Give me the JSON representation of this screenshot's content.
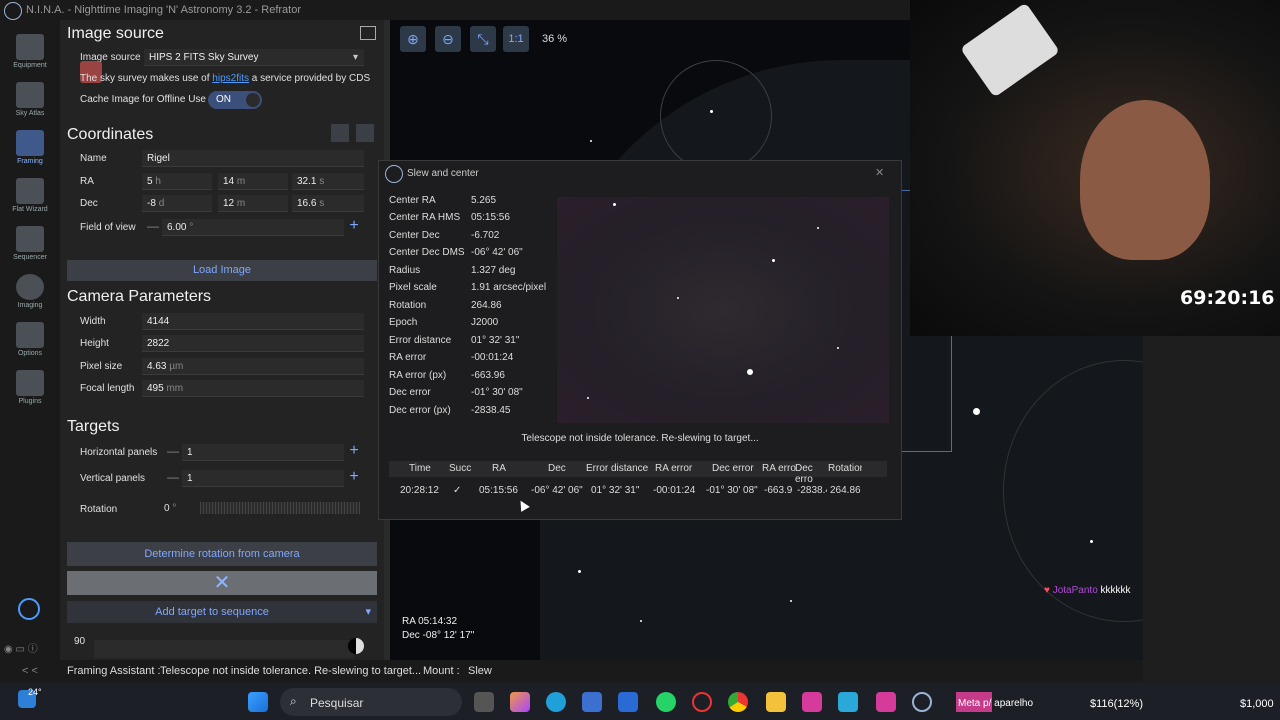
{
  "titlebar": {
    "title": "N.I.N.A. - Nighttime Imaging 'N' Astronomy 3.2  -  Refrator"
  },
  "nav": [
    {
      "label": "Equipment",
      "icon": "telescope-icon"
    },
    {
      "label": "Sky Atlas",
      "icon": "sky-atlas-icon"
    },
    {
      "label": "Framing",
      "icon": "framing-icon"
    },
    {
      "label": "Flat Wizard",
      "icon": "flat-wizard-icon"
    },
    {
      "label": "Sequencer",
      "icon": "sequencer-icon"
    },
    {
      "label": "Imaging",
      "icon": "imaging-icon"
    },
    {
      "label": "Options",
      "icon": "gear-icon"
    },
    {
      "label": "Plugins",
      "icon": "puzzle-icon"
    }
  ],
  "image_source": {
    "heading": "Image source",
    "label": "Image source",
    "value": "HIPS 2 FITS Sky Survey",
    "note_prefix": "The sky survey makes use of ",
    "note_link": "hips2fits",
    "note_suffix": " a service provided by CDS",
    "cache_label": "Cache Image for Offline Use",
    "cache_toggle": "ON"
  },
  "coordinates": {
    "heading": "Coordinates",
    "name_label": "Name",
    "name_value": "Rigel",
    "ra_label": "RA",
    "ra_h": "5",
    "ra_h_unit": "h",
    "ra_m": "14",
    "ra_m_unit": "m",
    "ra_s": "32.1",
    "ra_s_unit": "s",
    "dec_label": "Dec",
    "dec_d": "-8",
    "dec_d_unit": "d",
    "dec_m": "12",
    "dec_m_unit": "m",
    "dec_s": "16.6",
    "dec_s_unit": "s",
    "fov_label": "Field of view",
    "fov_minus": "—",
    "fov_value": "6.00",
    "fov_unit": "°",
    "fov_plus": "+"
  },
  "load_image": "Load Image",
  "camera": {
    "heading": "Camera Parameters",
    "width_label": "Width",
    "width_value": "4144",
    "height_label": "Height",
    "height_value": "2822",
    "pixel_label": "Pixel size",
    "pixel_value": "4.63",
    "pixel_unit": "µm",
    "focal_label": "Focal length",
    "focal_value": "495",
    "focal_unit": "mm"
  },
  "targets": {
    "heading": "Targets",
    "hpanels_label": "Horizontal panels",
    "hpanels_minus": "—",
    "hpanels_value": "1",
    "hpanels_plus": "+",
    "vpanels_label": "Vertical panels",
    "vpanels_minus": "—",
    "vpanels_value": "1",
    "vpanels_plus": "+",
    "rotation_label": "Rotation",
    "rotation_value": "0",
    "rotation_unit": "°"
  },
  "determine_rotation": "Determine rotation from camera",
  "add_target": "Add target to sequence",
  "opacity_value": "90",
  "toolbar": {
    "one_to_one": "1:1",
    "zoom": "36 %"
  },
  "sky_readout": {
    "ra": "RA  05:14:32",
    "dec": "Dec  -08° 12' 17\""
  },
  "dialog": {
    "title": "Slew and center",
    "close": "✕",
    "fields": [
      {
        "k": "Center RA",
        "v": "5.265"
      },
      {
        "k": "Center RA HMS",
        "v": "05:15:56"
      },
      {
        "k": "Center Dec",
        "v": "-6.702"
      },
      {
        "k": "Center Dec DMS",
        "v": "-06° 42' 06\""
      },
      {
        "k": "Radius",
        "v": "1.327 deg"
      },
      {
        "k": "Pixel scale",
        "v": "1.91 arcsec/pixel"
      },
      {
        "k": "Rotation",
        "v": "264.86"
      },
      {
        "k": "Epoch",
        "v": "J2000"
      },
      {
        "k": "Error distance",
        "v": "01° 32' 31\""
      },
      {
        "k": "RA error",
        "v": "-00:01:24"
      },
      {
        "k": "RA error (px)",
        "v": "-663.96"
      },
      {
        "k": "Dec error",
        "v": "-01° 30' 08\""
      },
      {
        "k": "Dec error (px)",
        "v": "-2838.45"
      }
    ],
    "message": "Telescope not inside tolerance. Re-slewing to target...",
    "table_headers": [
      "Time",
      "Succ",
      "RA",
      "Dec",
      "Error distance",
      "RA error",
      "Dec error",
      "RA erro",
      "Dec erro",
      "Rotation"
    ],
    "table_row": [
      "20:28:12",
      "✓",
      "05:15:56",
      "-06° 42' 06\"",
      "01° 32' 31\"",
      "-00:01:24",
      "-01° 30' 08\"",
      "-663.9",
      "-2838.4",
      "264.86"
    ]
  },
  "webcam": {
    "timer": "69:20:16"
  },
  "chat": {
    "user": "JotaPanto",
    "message": "kkkkkk"
  },
  "status": {
    "collapse": "< <",
    "source1": "Framing Assistant :",
    "msg1": "Telescope not inside tolerance. Re-slewing to target...",
    "source2": "Mount :",
    "msg2": "Slew"
  },
  "taskbar": {
    "weather": "24°",
    "search": "Pesquisar",
    "meta_prefix": "Meta p/",
    "meta_suffix": " aparelho",
    "goal1": "$116(12%)",
    "goal2": "$1,000"
  },
  "colors": {
    "accent": "#7fa8ff",
    "link": "#4a9cff",
    "toggle": "#3a4f7a"
  }
}
